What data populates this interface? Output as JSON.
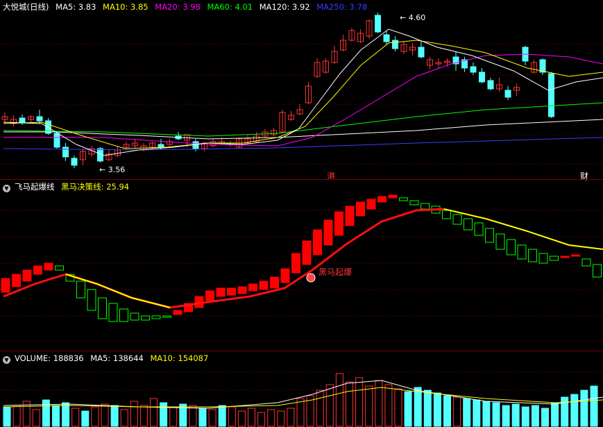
{
  "main": {
    "stock_label": "大悦城(日线)",
    "ma": [
      {
        "label": "MA5:",
        "value": "3.83",
        "color": "#ffffff"
      },
      {
        "label": "MA10:",
        "value": "3.85",
        "color": "#ffff00"
      },
      {
        "label": "MA20:",
        "value": "3.98",
        "color": "#ff00ff"
      },
      {
        "label": "MA60:",
        "value": "4.01",
        "color": "#00ff00"
      },
      {
        "label": "MA120:",
        "value": "3.92",
        "color": "#ffffff"
      },
      {
        "label": "MA250:",
        "value": "3.78",
        "color": "#0000ff"
      }
    ],
    "high_label": "4.60",
    "low_label": "3.56",
    "marker_left": "港",
    "marker_right": "财"
  },
  "indicator": {
    "name": "飞马起爆线",
    "line_label": "黑马决策线:",
    "line_value": "25.94",
    "signal_label": "黑马起爆"
  },
  "volume": {
    "label": "VOLUME:",
    "value": "188836",
    "ma5_label": "MA5:",
    "ma5_value": "138644",
    "ma10_label": "MA10:",
    "ma10_value": "154087"
  },
  "colors": {
    "up": "#ff3232",
    "down": "#54ffff",
    "background": "#000000",
    "separator": "#7a0000"
  }
}
